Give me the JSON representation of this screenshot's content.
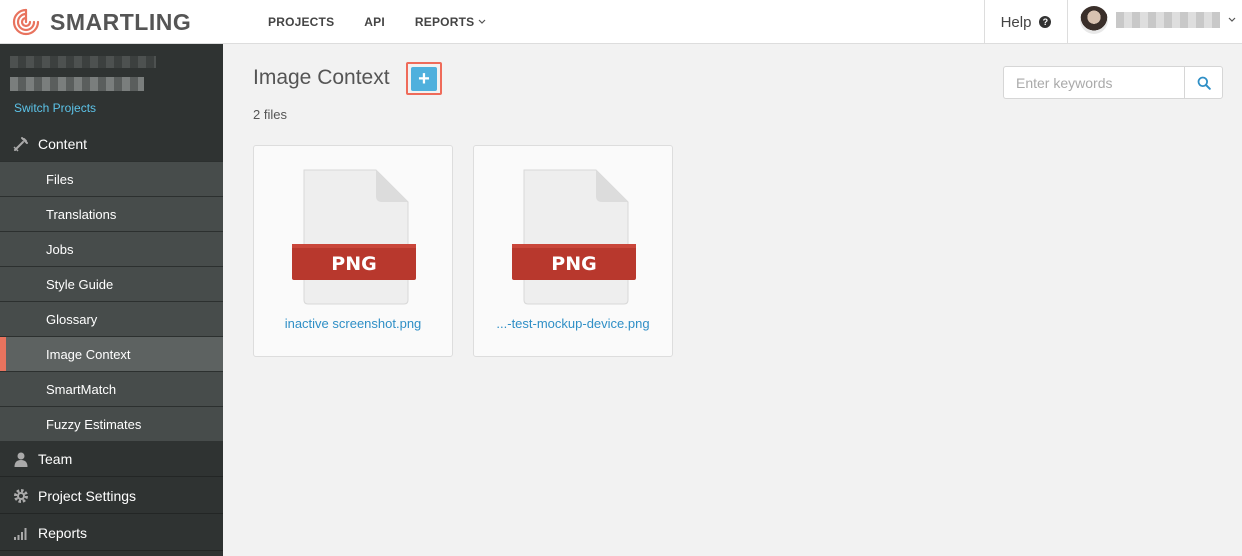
{
  "brand": {
    "name": "SMARTLING",
    "logo_color": "#e8735e"
  },
  "topnav": [
    {
      "label": "PROJECTS"
    },
    {
      "label": "API"
    },
    {
      "label": "REPORTS"
    }
  ],
  "help": {
    "label": "Help",
    "icon": "question-icon"
  },
  "sidebar": {
    "switch_projects": "Switch Projects",
    "sections": {
      "content": "Content",
      "team": "Team",
      "project_settings": "Project Settings",
      "reports": "Reports"
    },
    "items": [
      {
        "label": "Files"
      },
      {
        "label": "Translations"
      },
      {
        "label": "Jobs"
      },
      {
        "label": "Style Guide"
      },
      {
        "label": "Glossary"
      },
      {
        "label": "Image Context",
        "active": true
      },
      {
        "label": "SmartMatch"
      },
      {
        "label": "Fuzzy Estimates"
      }
    ]
  },
  "main": {
    "title": "Image Context",
    "add_button": "+",
    "file_count": "2 files",
    "search": {
      "placeholder": "Enter keywords"
    },
    "files": [
      {
        "name": "inactive screenshot.png",
        "type": "PNG"
      },
      {
        "name": "...-test-mockup-device.png",
        "type": "PNG"
      }
    ]
  },
  "colors": {
    "accent": "#4fb0dd",
    "highlight": "#ef6b5a",
    "link": "#2f8fc6",
    "file_badge": "#b8382d"
  }
}
